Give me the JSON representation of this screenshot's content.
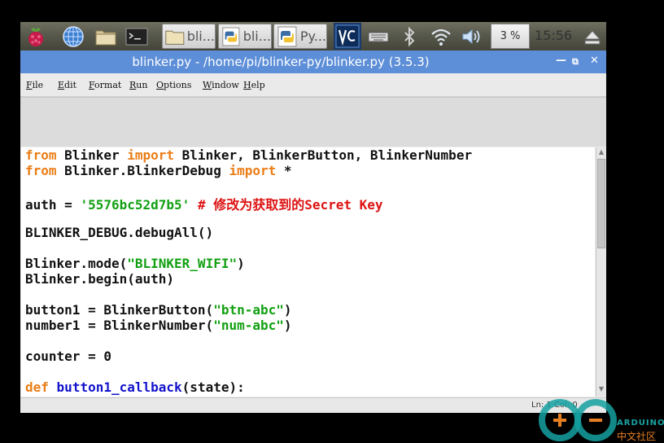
{
  "taskbar": {
    "buttons": [
      {
        "icon": "folder-icon",
        "label": "bli..."
      },
      {
        "icon": "python-icon",
        "label": "bli..."
      },
      {
        "icon": "python-icon",
        "label": "Py..."
      }
    ],
    "cpu": "3 %",
    "clock": "15:56"
  },
  "window": {
    "title": "blinker.py - /home/pi/blinker-py/blinker.py (3.5.3)",
    "menu": [
      {
        "key": "F",
        "rest": "ile"
      },
      {
        "key": "E",
        "rest": "dit"
      },
      {
        "key": "F",
        "rest": "ormat"
      },
      {
        "key": "R",
        "rest": "un"
      },
      {
        "key": "O",
        "rest": "ptions"
      },
      {
        "key": "W",
        "rest": "indow"
      },
      {
        "key": "H",
        "rest": "elp"
      }
    ],
    "status": "Ln: 1  Col: 0"
  },
  "code": {
    "l1": {
      "k1": "from",
      "t1": " Blinker ",
      "k2": "import",
      "t2": " Blinker, BlinkerButton, BlinkerNumber"
    },
    "l2": {
      "k1": "from",
      "t1": " Blinker.BlinkerDebug ",
      "k2": "import",
      "t2": " *"
    },
    "l3": {
      "t1": "auth = ",
      "s1": "'5576bc52d7b5'",
      "t2": " ",
      "c1": "# 修改为获取到的Secret Key"
    },
    "l4": {
      "t1": "BLINKER_DEBUG.debugAll()"
    },
    "l5": {
      "t1": "Blinker.mode(",
      "s1": "\"BLINKER_WIFI\"",
      "t2": ")"
    },
    "l6": {
      "t1": "Blinker.begin(auth)"
    },
    "l7": {
      "t1": "button1 = BlinkerButton(",
      "s1": "\"btn-abc\"",
      "t2": ")"
    },
    "l8": {
      "t1": "number1 = BlinkerNumber(",
      "s1": "\"num-abc\"",
      "t2": ")"
    },
    "l9": {
      "t1": "counter = 0"
    },
    "l10": {
      "k1": "def",
      "t1": " ",
      "f1": "button1_callback",
      "t2": "(state):"
    }
  },
  "watermark": {
    "word": "ARDUINO",
    "cn": "中文社区"
  },
  "colors": {
    "keyword": "#ea7d16",
    "string": "#12a012",
    "comment": "#dd1212",
    "function": "#1212cc",
    "titlebar": "#5d8ed8"
  }
}
